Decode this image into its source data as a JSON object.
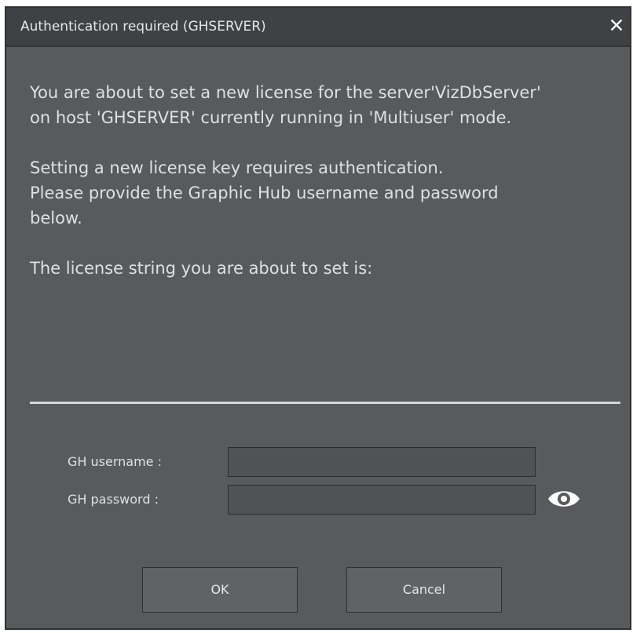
{
  "dialog": {
    "title": "Authentication required (GHSERVER)",
    "close_glyph": "✕"
  },
  "message": {
    "line1": "You are about to set a new license for the server'VizDbServer'",
    "line2": "on host 'GHSERVER' currently running in 'Multiuser' mode.",
    "line3": "Setting a new license key requires authentication.",
    "line4": "Please provide the Graphic Hub username and password",
    "line5": "below.",
    "line6": "The license string you are about to set is:"
  },
  "form": {
    "username_label": "GH username :",
    "username_value": "",
    "password_label": "GH password :",
    "password_value": "",
    "reveal_icon": "eye-icon"
  },
  "buttons": {
    "ok_label": "OK",
    "cancel_label": "Cancel"
  },
  "colors": {
    "dialog_bg": "#585a5d",
    "titlebar_bg": "#3f4144",
    "text": "#e0e0e0",
    "separator": "#d6d6d6"
  }
}
